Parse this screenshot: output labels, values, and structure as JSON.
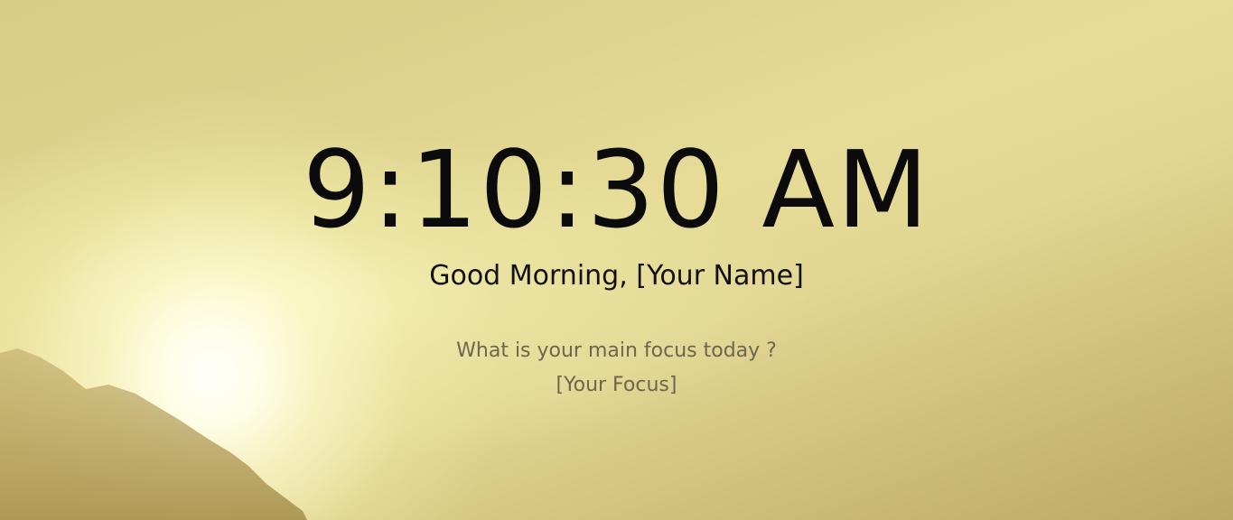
{
  "clock": {
    "time": "9:10:30 AM"
  },
  "greeting": {
    "text": "Good Morning, [Your Name]"
  },
  "focus": {
    "question": "What is your main focus today ?",
    "value": "[Your Focus]"
  },
  "colors": {
    "text_primary": "#0b0b0b",
    "text_secondary": "#6c6650",
    "background_warm": "#ded38e"
  }
}
